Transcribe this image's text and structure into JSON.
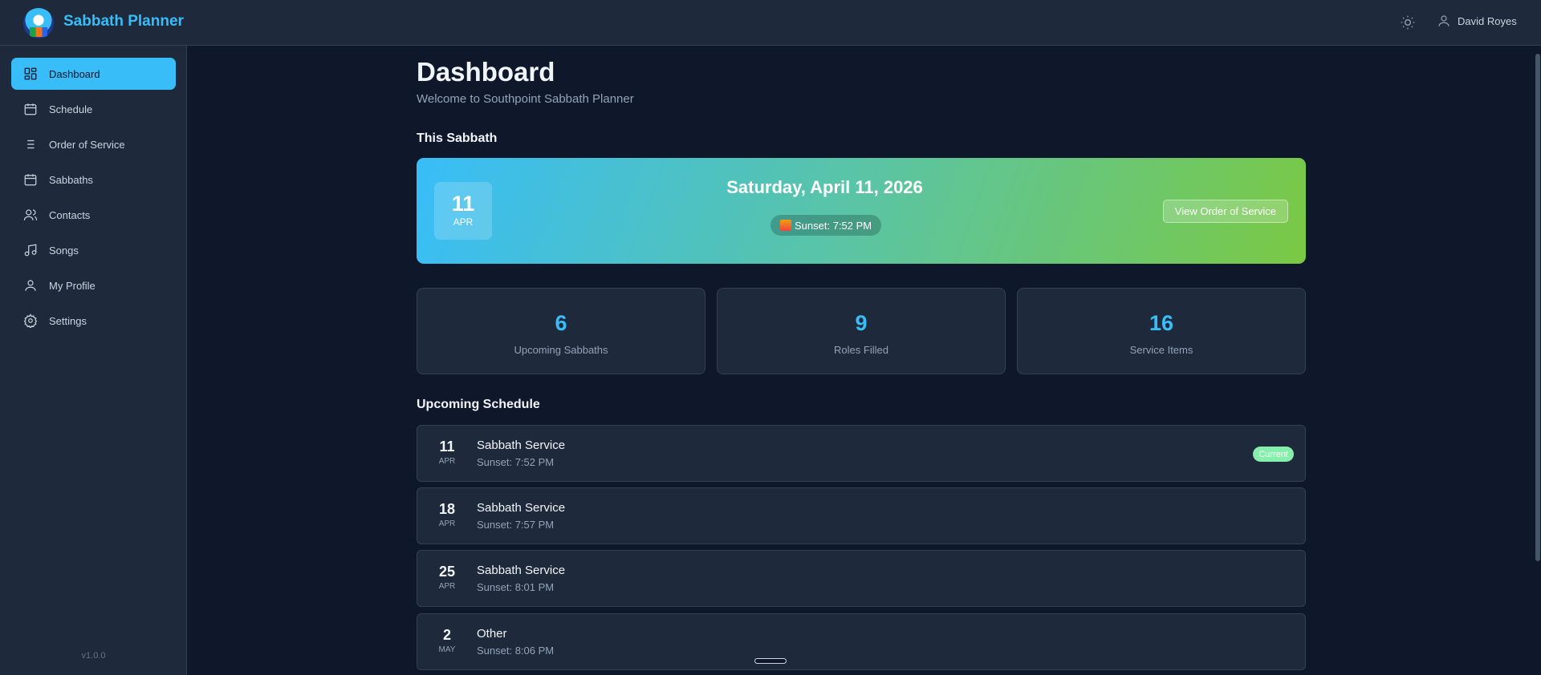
{
  "app": {
    "title": "Sabbath Planner",
    "user": "David Royes",
    "version": "v1.0.0"
  },
  "sidebar": {
    "items": [
      {
        "label": "Dashboard",
        "icon": "dashboard-icon"
      },
      {
        "label": "Schedule",
        "icon": "calendar-icon"
      },
      {
        "label": "Order of Service",
        "icon": "list-icon"
      },
      {
        "label": "Sabbaths",
        "icon": "calendar-icon"
      },
      {
        "label": "Contacts",
        "icon": "users-icon"
      },
      {
        "label": "Songs",
        "icon": "music-icon"
      },
      {
        "label": "My Profile",
        "icon": "user-icon"
      },
      {
        "label": "Settings",
        "icon": "gear-icon"
      }
    ]
  },
  "page": {
    "title": "Dashboard",
    "subtitle": "Welcome to Southpoint Sabbath Planner",
    "this_sabbath": "This Sabbath",
    "upcoming": "Upcoming Schedule"
  },
  "banner": {
    "day": "11",
    "month": "APR",
    "title": "Saturday, April 11, 2026",
    "sunset": "Sunset: 7:52 PM",
    "button": "View Order of Service"
  },
  "stats": [
    {
      "value": "6",
      "label": "Upcoming Sabbaths"
    },
    {
      "value": "9",
      "label": "Roles Filled"
    },
    {
      "value": "16",
      "label": "Service Items"
    }
  ],
  "schedule": [
    {
      "day": "11",
      "month": "APR",
      "title": "Sabbath Service",
      "sunset": "Sunset: 7:52 PM",
      "badge": "Current"
    },
    {
      "day": "18",
      "month": "APR",
      "title": "Sabbath Service",
      "sunset": "Sunset: 7:57 PM"
    },
    {
      "day": "25",
      "month": "APR",
      "title": "Sabbath Service",
      "sunset": "Sunset: 8:01 PM"
    },
    {
      "day": "2",
      "month": "MAY",
      "title": "Other",
      "sunset": "Sunset: 8:06 PM"
    }
  ]
}
